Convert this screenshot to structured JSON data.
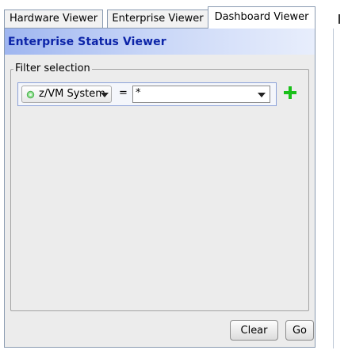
{
  "tabs": [
    {
      "label": "Hardware Viewer",
      "active": false
    },
    {
      "label": "Enterprise Viewer",
      "active": false
    },
    {
      "label": "Dashboard Viewer",
      "active": true
    }
  ],
  "panel": {
    "title": "Enterprise Status Viewer",
    "filter_group_label": "Filter selection",
    "filter": {
      "type_label": "z/VM System",
      "type_icon": "gear-icon",
      "operator": "=",
      "value": "*"
    },
    "buttons": {
      "clear_label": "Clear",
      "go_label": "Go"
    }
  },
  "colors": {
    "header_title": "#0c24a8",
    "add_icon": "#19c019"
  }
}
